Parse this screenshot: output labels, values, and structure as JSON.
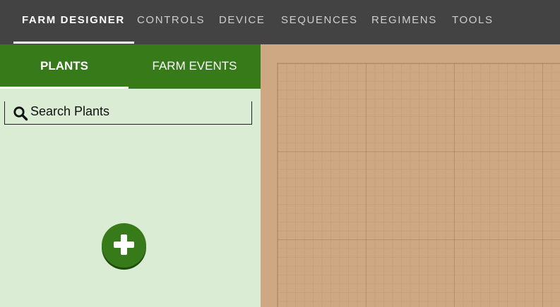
{
  "nav": {
    "items": [
      {
        "label": "FARM DESIGNER",
        "active": true
      },
      {
        "label": "CONTROLS"
      },
      {
        "label": "DEVICE"
      },
      {
        "label": "SEQUENCES"
      },
      {
        "label": "REGIMENS"
      },
      {
        "label": "TOOLS"
      }
    ]
  },
  "sidebar": {
    "tabs": [
      {
        "label": "PLANTS",
        "active": true
      },
      {
        "label": "FARM EVENTS"
      }
    ],
    "search": {
      "placeholder": "Search Plants",
      "value": "",
      "icon": "search-icon"
    },
    "add_button": {
      "icon": "plus-icon"
    }
  },
  "colors": {
    "nav_bg": "#434343",
    "tab_bg": "#367a1a",
    "sidebar_bg": "#daecd4",
    "map_bg": "#cda883"
  }
}
